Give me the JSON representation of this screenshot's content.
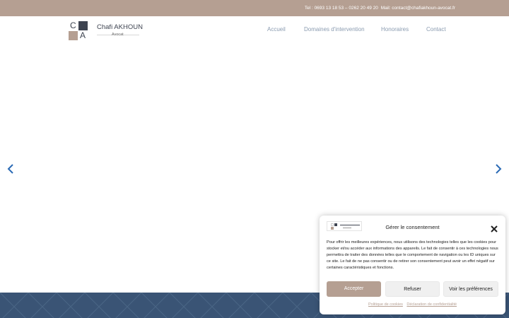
{
  "topbar": {
    "tel_prefix": "Tel :",
    "tel_numbers": "0693 13 18 53 – 0262 20 49 20",
    "mail_prefix": "Mail:",
    "mail_address": "contact@chafiakhoun-avocat.fr"
  },
  "logo": {
    "letter_c": "C",
    "letter_a": "A",
    "name": "Chafi AKHOUN",
    "subtitle": "Avocat"
  },
  "nav": {
    "items": [
      "Accueil",
      "Domaines d'intervention",
      "Honoraires",
      "Contact"
    ]
  },
  "slider": {
    "prev_icon": "chevron-left-icon",
    "next_icon": "chevron-right-icon"
  },
  "consent": {
    "title": "Gérer le consentement",
    "text": "Pour offrir les meilleures expériences, nous utilisons des technologies telles que les cookies pour stocker et/ou accéder aux informations des appareils. Le fait de consentir à ces technologies nous permettra de traiter des données telles que le comportement de navigation ou les ID uniques sur ce site. Le fait de ne pas consentir ou de retirer son consentement peut avoir un effet négatif sur certaines caractéristiques et fonctions.",
    "accept_label": "Accepter",
    "refuse_label": "Refuser",
    "prefs_label": "Voir les préférences",
    "cookie_policy_label": "Politique de cookies",
    "privacy_label": "Déclaration de confidentialité",
    "close_icon": "close-icon"
  },
  "colors": {
    "brand_taupe": "#b59f92",
    "brand_dark": "#3e4451",
    "footer_blue": "#3a5475",
    "link_blue": "#2a6ab5"
  }
}
